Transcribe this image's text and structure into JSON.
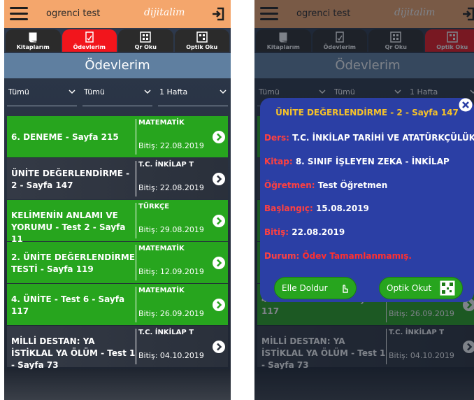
{
  "app": {
    "user_name": "ogrenci test",
    "logo_text": "dijitalim",
    "hamburger_icon": "hamburger-menu-icon",
    "logout_icon": "logout-icon",
    "header_color": "#f4a66c"
  },
  "tabs": [
    {
      "label": "Kitaplarım",
      "icon": "book-icon"
    },
    {
      "label": "Ödevlerim",
      "icon": "homework-icon"
    },
    {
      "label": "Qr Oku",
      "icon": "qr-code-icon"
    },
    {
      "label": "Optik Oku",
      "icon": "optical-form-icon"
    }
  ],
  "active_tab_left": "Ödevlerim",
  "active_tab_right": "Optik Oku",
  "active_tab_color": "#f2151c",
  "page_title": "Ödevlerim",
  "filters": [
    {
      "value": "Tümü"
    },
    {
      "value": "Tümü"
    },
    {
      "value": "1 Hafta"
    }
  ],
  "assignments": [
    {
      "title": "6. DENEME - Sayfa 215",
      "subject": "MATEMATİK",
      "due": "Bitiş: 22.08.2019",
      "status_color": "green"
    },
    {
      "title": "ÜNİTE DEĞERLENDİRME - 2 - Sayfa 147",
      "subject": "T.C. İNKİLAP T",
      "due": "Bitiş: 22.08.2019",
      "status_color": "dark"
    },
    {
      "title": "KELİMENİN ANLAMI VE YORUMU - Test 2 - Sayfa 11",
      "subject": "TÜRKÇE",
      "due": "Bitiş: 29.08.2019",
      "status_color": "green"
    },
    {
      "title": "2. ÜNİTE DEĞERLENDİRME TESTİ - Sayfa 119",
      "subject": "MATEMATİK",
      "due": "Bitiş: 12.09.2019",
      "status_color": "green"
    },
    {
      "title": "4. ÜNİTE - Test 6 - Sayfa 117",
      "subject": "MATEMATİK",
      "due": "Bitiş: 26.09.2019",
      "status_color": "green"
    },
    {
      "title": "MİLLİ DESTAN: YA İSTİKLAL YA ÖLÜM - Test 1 - Sayfa 73",
      "subject": "T.C. İNKİLAP T",
      "due": "Bitiş: 04.10.2019",
      "status_color": "dark"
    }
  ],
  "colors": {
    "completed_green": "#27a51e",
    "pending_dark": "#343a46",
    "modal_blue": "#2b3fa5",
    "modal_title_yellow": "#f6c229",
    "label_red": "#ff4040"
  },
  "modal": {
    "title": "ÜNİTE DEĞERLENDİRME - 2 - Sayfa 147",
    "rows": [
      {
        "key": "Ders:",
        "value": "T.C. İNKİLAP TARİHİ VE ATATÜRKÇÜLÜK"
      },
      {
        "key": "Kitap:",
        "value": "8. SINIF İŞLEYEN ZEKA - İNKİLAP"
      },
      {
        "key": "Öğretmen:",
        "value": "Test Öğretmen"
      },
      {
        "key": "Başlangıç:",
        "value": "15.08.2019"
      },
      {
        "key": "Bitiş:",
        "value": "22.08.2019"
      },
      {
        "key": "Durum:",
        "value": "Ödev Tamamlanmamış."
      }
    ],
    "fill_button": "Elle Doldur",
    "fill_icon": "hand-pointer-icon",
    "scan_button": "Optik Okut",
    "scan_icon": "qr-scan-icon",
    "close_icon": "close-icon"
  }
}
